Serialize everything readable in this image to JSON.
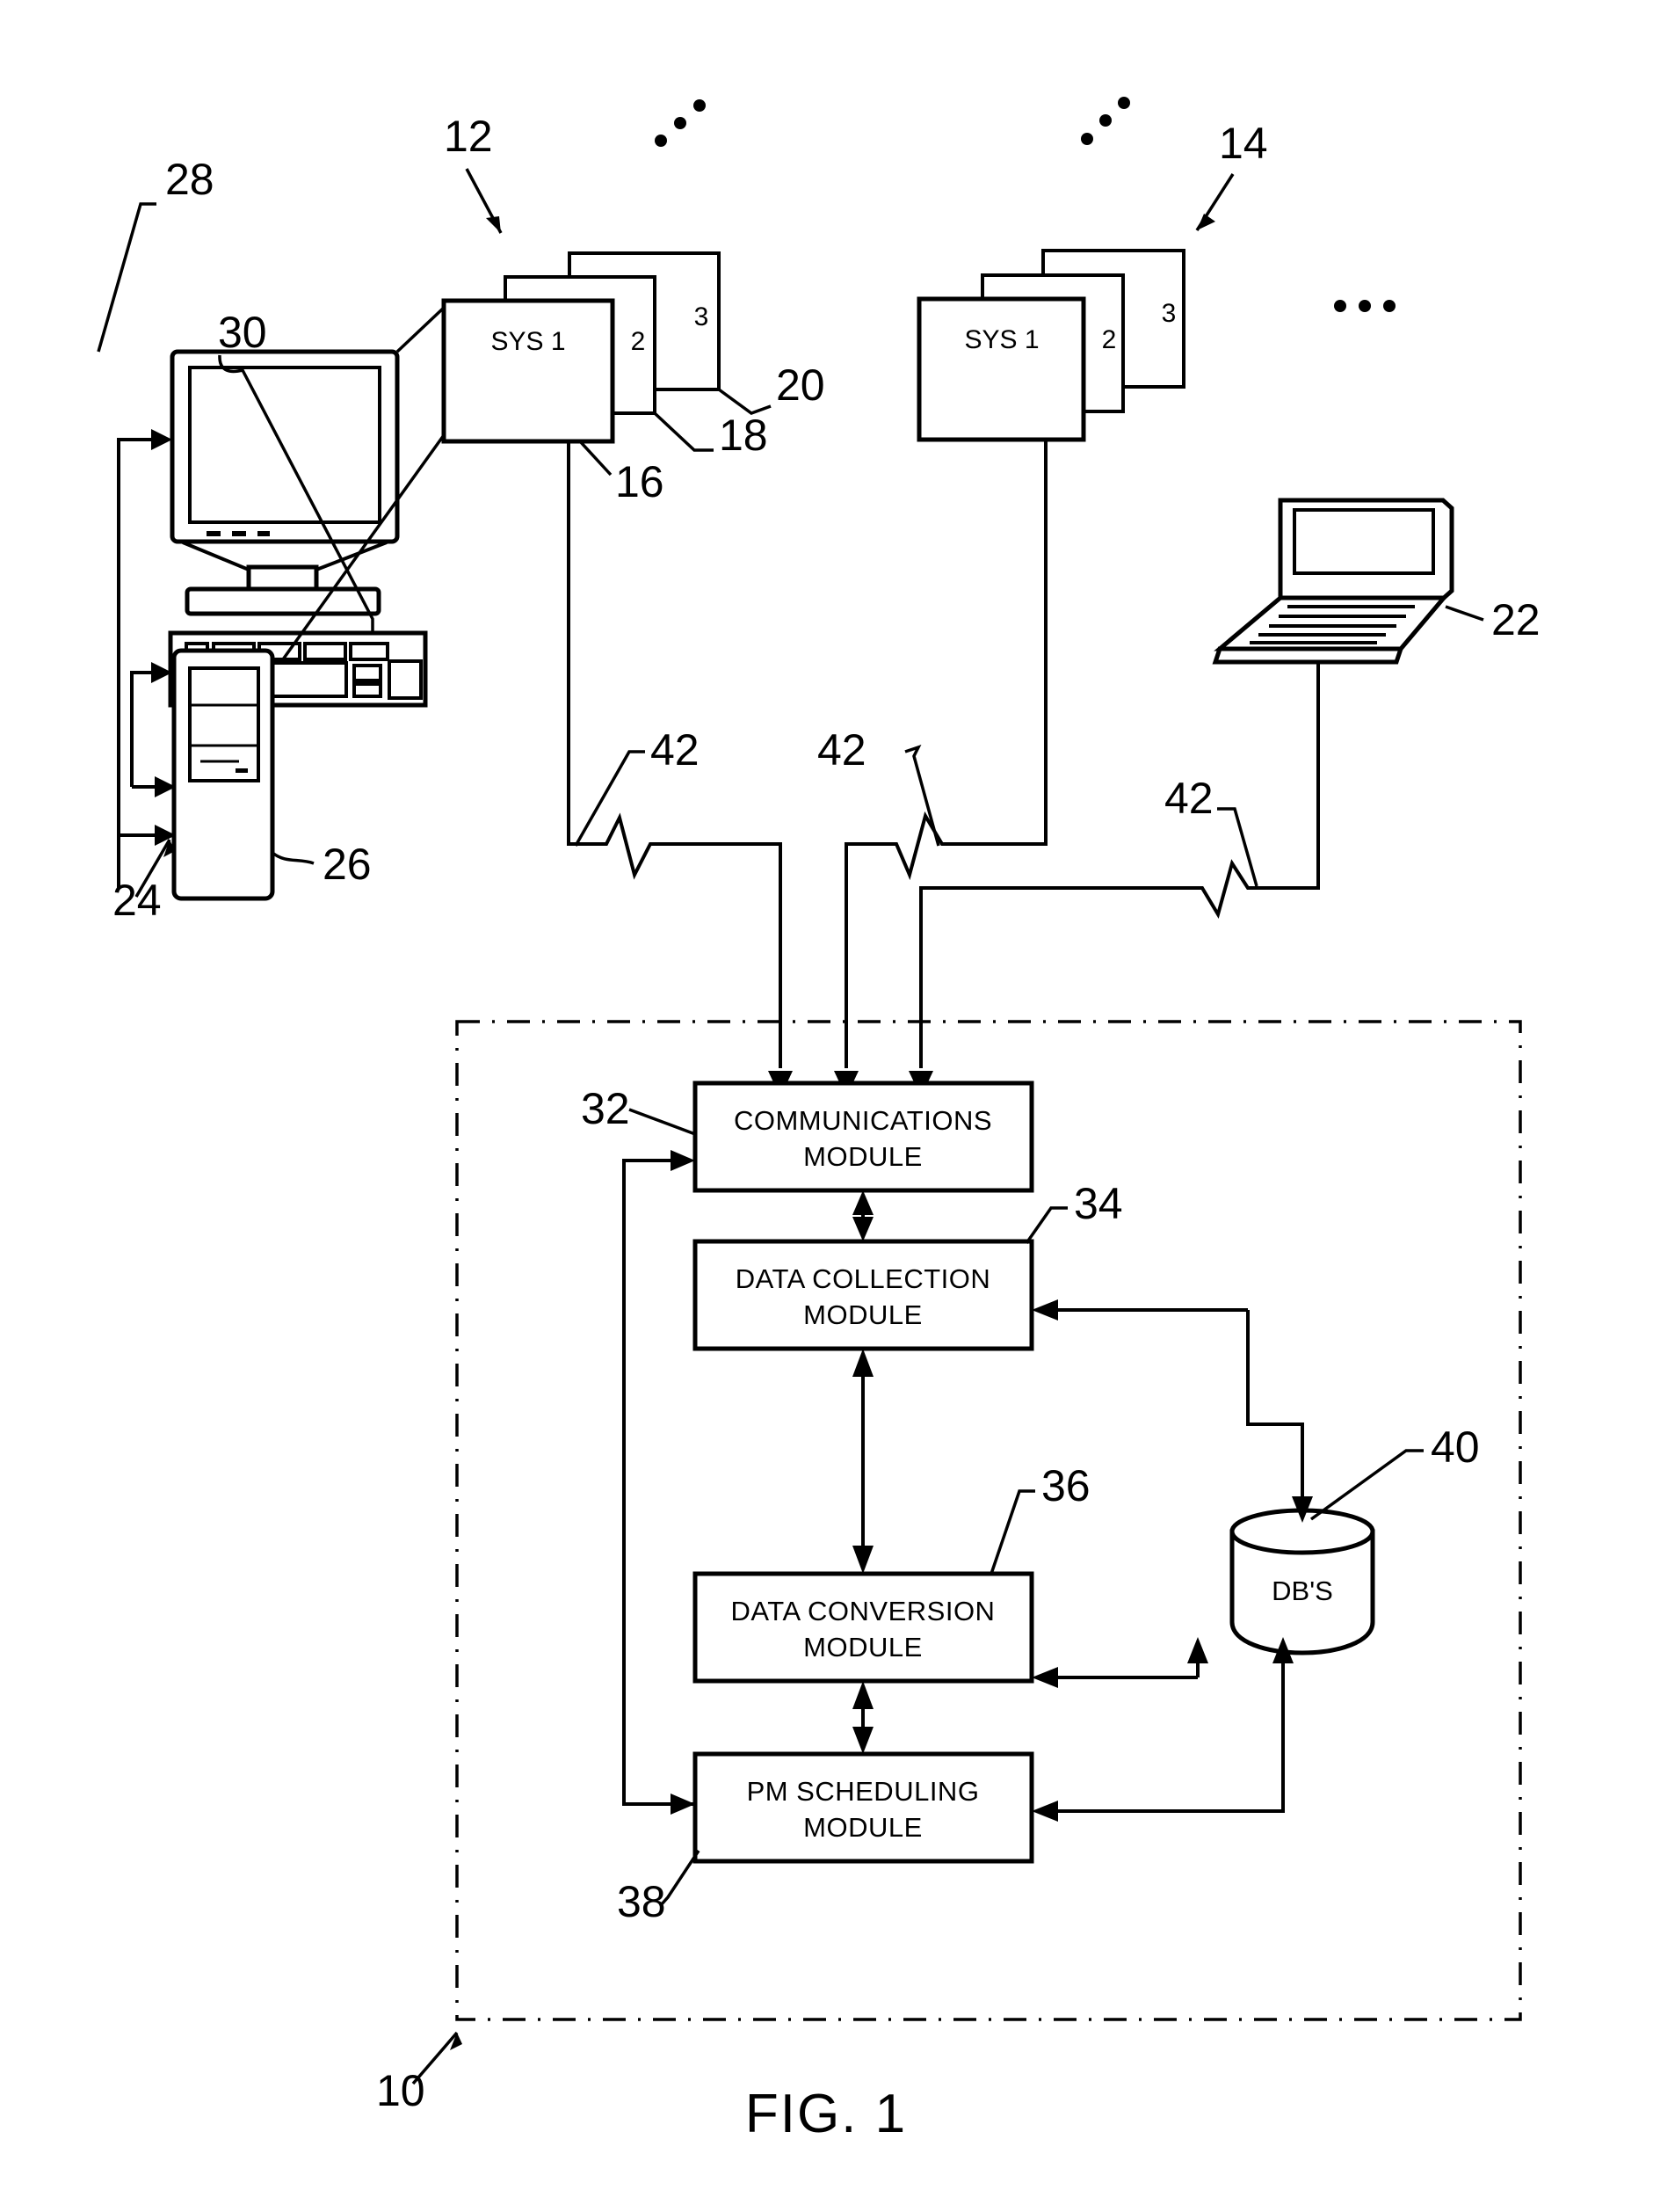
{
  "figure": {
    "caption": "FIG. 1",
    "type": "patent-system-block-diagram"
  },
  "reference_numerals": {
    "n10": "10",
    "n12": "12",
    "n14": "14",
    "n16": "16",
    "n18": "18",
    "n20": "20",
    "n22": "22",
    "n24": "24",
    "n26": "26",
    "n28": "28",
    "n30": "30",
    "n32": "32",
    "n34": "34",
    "n36": "36",
    "n38": "38",
    "n40": "40",
    "n42_left": "42",
    "n42_middle": "42",
    "n42_right": "42"
  },
  "system_group_left": {
    "label": "12",
    "boxes": [
      {
        "text": "SYS 1",
        "ref": "16"
      },
      {
        "text": "2",
        "ref": "18"
      },
      {
        "text": "3",
        "ref": "20"
      }
    ],
    "ellipsis": "..."
  },
  "system_group_right": {
    "label": "14",
    "boxes": [
      {
        "text": "SYS 1"
      },
      {
        "text": "2"
      },
      {
        "text": "3"
      }
    ],
    "ellipsis": "..."
  },
  "more_systems_ellipsis": "...",
  "workstation": {
    "ref": "24",
    "monitor_ref": "28",
    "keyboard_ref": "30",
    "tower_ref": "26"
  },
  "laptop": {
    "ref": "22"
  },
  "network_links": {
    "label": "42",
    "count": 3
  },
  "server_system": {
    "ref": "10",
    "modules": [
      {
        "line1": "COMMUNICATIONS",
        "line2": "MODULE",
        "ref": "32"
      },
      {
        "line1": "DATA COLLECTION",
        "line2": "MODULE",
        "ref": "34"
      },
      {
        "line1": "DATA CONVERSION",
        "line2": "MODULE",
        "ref": "36"
      },
      {
        "line1": "PM SCHEDULING",
        "line2": "MODULE",
        "ref": "38"
      }
    ],
    "database": {
      "label": "DB'S",
      "ref": "40"
    }
  },
  "colors": {
    "ink": "#000000",
    "paper": "#ffffff"
  }
}
